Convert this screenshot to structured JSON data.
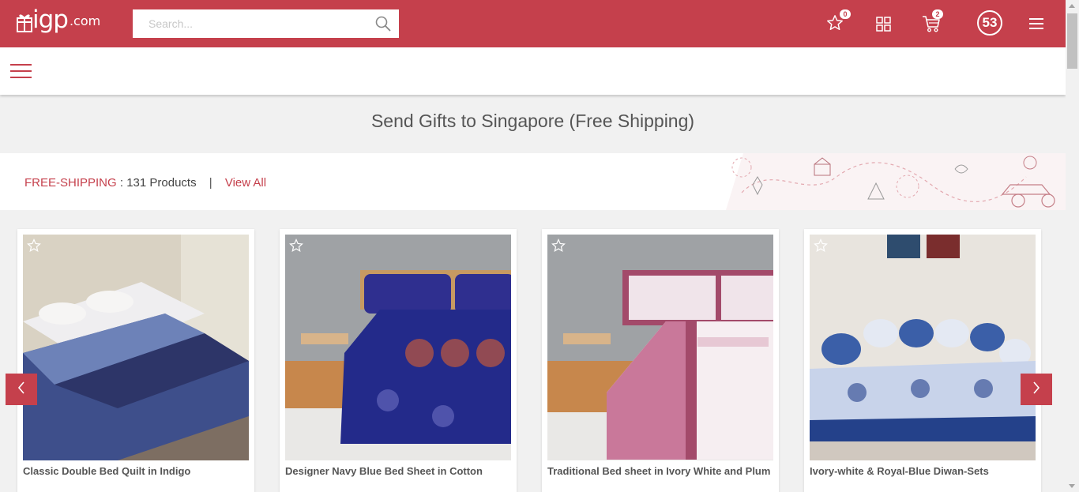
{
  "header": {
    "logo_text": "igp",
    "logo_suffix": ".com",
    "search_placeholder": "Search...",
    "wishlist_count": "0",
    "cart_count": "2",
    "profile_initials": "53",
    "icons": [
      "gift-icon",
      "search-icon",
      "star-icon",
      "grid-icon",
      "cart-icon",
      "hamburger-icon"
    ]
  },
  "page": {
    "heading": "Send Gifts to Singapore (Free Shipping)"
  },
  "strip": {
    "label": "FREE-SHIPPING",
    "count_text": ": 131 Products",
    "separator": "|",
    "view_all": "View All"
  },
  "products": [
    {
      "title": "Classic Double Bed Quilt in Indigo"
    },
    {
      "title": "Designer Navy Blue Bed Sheet in Cotton"
    },
    {
      "title": "Traditional Bed sheet in Ivory White and Plum"
    },
    {
      "title": "Ivory-white & Royal-Blue Diwan-Sets"
    }
  ],
  "colors": {
    "brand": "#c5404c",
    "heading": "#555555",
    "page_bg": "#f1f1f1"
  }
}
